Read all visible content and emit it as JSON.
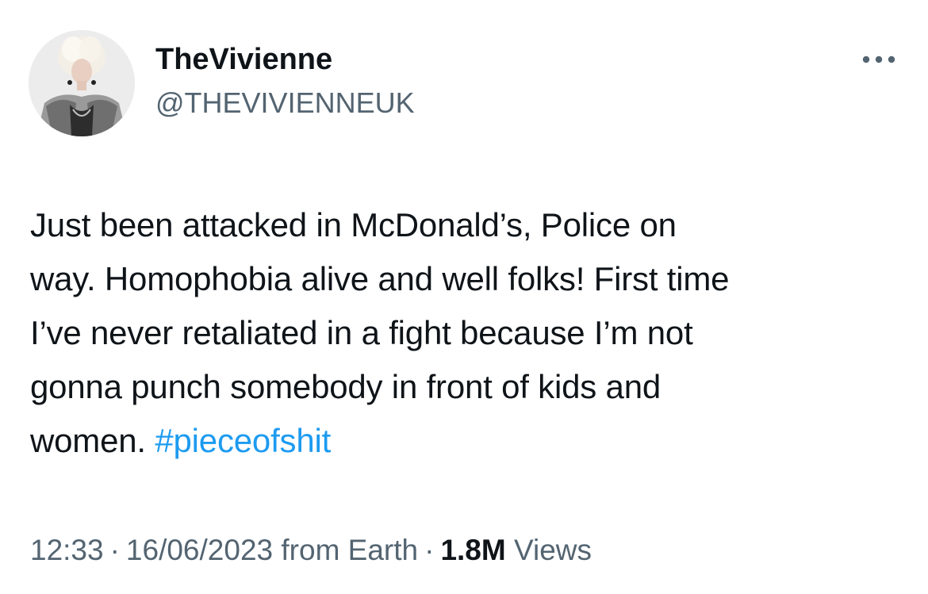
{
  "author": {
    "display_name": "TheVivienne",
    "handle": "@THEVIVIENNEUK",
    "avatar_icon": "profile-photo"
  },
  "more_icon": "more-horizontal-icon",
  "tweet": {
    "lines": [
      "Just been attacked in McDonald’s, Police on",
      "way. Homophobia alive and well folks! First time",
      "I’ve never retaliated in a fight because I’m not",
      "gonna punch somebody in front of kids and",
      "women. "
    ],
    "hashtag": "#pieceofshit"
  },
  "meta": {
    "time": "12:33",
    "separator": "·",
    "date": "16/06/2023",
    "source": "from Earth",
    "views_count": "1.8M",
    "views_label": "Views"
  },
  "colors": {
    "text": "#0f1419",
    "secondary": "#536471",
    "link": "#1d9bf0"
  }
}
